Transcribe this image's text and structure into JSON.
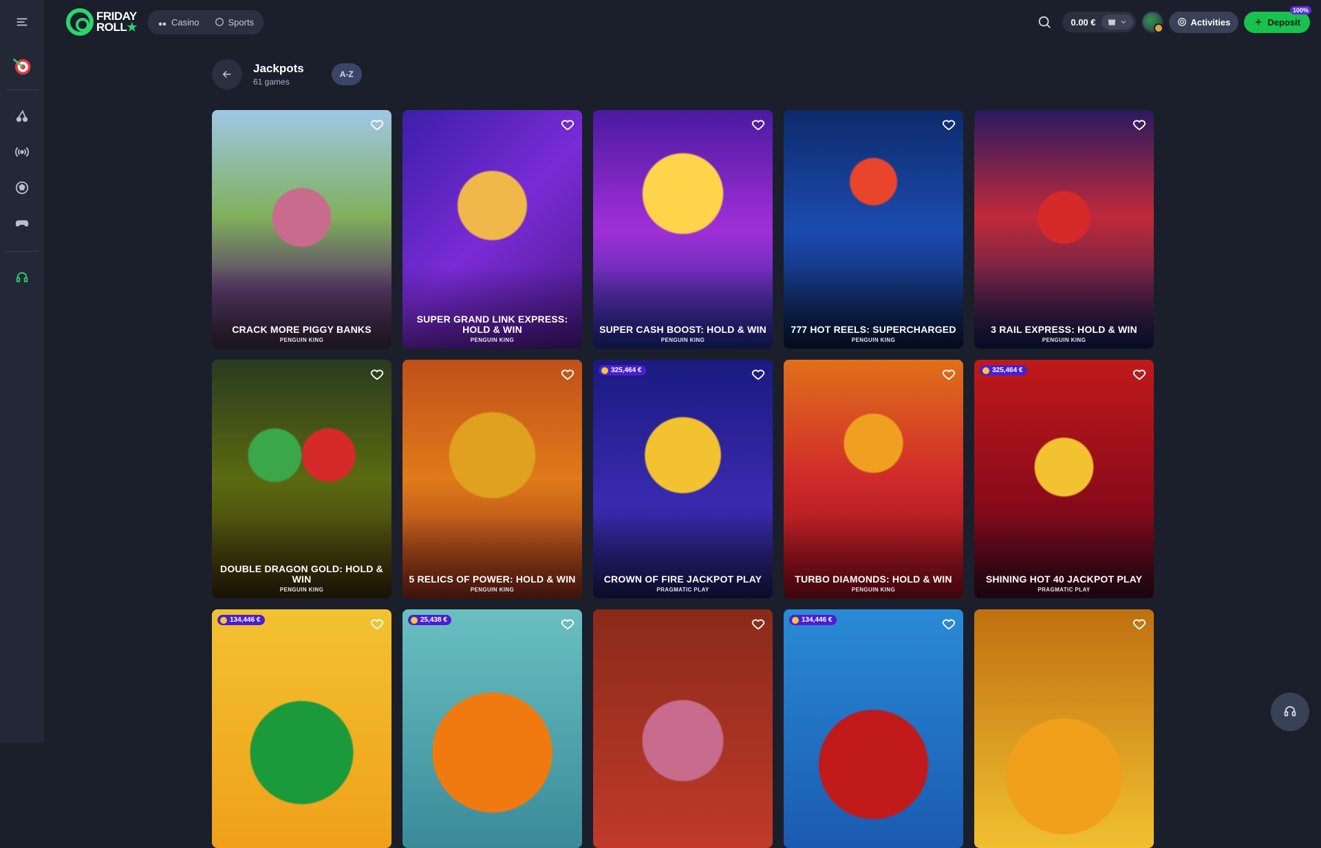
{
  "brand": {
    "name_line1": "FRIDAY",
    "name_line2": "ROLL",
    "name_star": "★"
  },
  "nav": {
    "casino_label": "Casino",
    "sports_label": "Sports"
  },
  "account": {
    "balance": "0.00 €",
    "activities_label": "Activities",
    "deposit_label": "Deposit",
    "deposit_badge": "100%"
  },
  "page": {
    "title": "Jackpots",
    "subtitle": "61 games",
    "sort_label": "A-Z"
  },
  "games": [
    {
      "name": "CRACK MORE PIGGY BANKS",
      "provider": "PENGUIN KING",
      "jackpot": ""
    },
    {
      "name": "SUPER GRAND LINK EXPRESS: HOLD & WIN",
      "provider": "PENGUIN KING",
      "jackpot": ""
    },
    {
      "name": "SUPER CASH BOOST: HOLD & WIN",
      "provider": "PENGUIN KING",
      "jackpot": ""
    },
    {
      "name": "777 HOT REELS: SUPERCHARGED",
      "provider": "PENGUIN KING",
      "jackpot": ""
    },
    {
      "name": "3 RAIL EXPRESS: HOLD & WIN",
      "provider": "PENGUIN KING",
      "jackpot": ""
    },
    {
      "name": "DOUBLE DRAGON GOLD: HOLD & WIN",
      "provider": "PENGUIN KING",
      "jackpot": ""
    },
    {
      "name": "5 RELICS OF POWER: HOLD & WIN",
      "provider": "PENGUIN KING",
      "jackpot": ""
    },
    {
      "name": "CROWN OF FIRE JACKPOT PLAY",
      "provider": "PRAGMATIC PLAY",
      "jackpot": "325,464 €"
    },
    {
      "name": "TURBO DIAMONDS: HOLD & WIN",
      "provider": "PENGUIN KING",
      "jackpot": ""
    },
    {
      "name": "SHINING HOT 40 JACKPOT PLAY",
      "provider": "PRAGMATIC PLAY",
      "jackpot": "325,464 €"
    },
    {
      "name": "",
      "provider": "",
      "jackpot": "134,446 €"
    },
    {
      "name": "",
      "provider": "",
      "jackpot": "25,438 €"
    },
    {
      "name": "",
      "provider": "",
      "jackpot": ""
    },
    {
      "name": "",
      "provider": "",
      "jackpot": "134,446 €"
    },
    {
      "name": "",
      "provider": "",
      "jackpot": ""
    }
  ],
  "colors": {
    "accent_green": "#19c14e",
    "jackpot_badge": "#4b1fd1",
    "background": "#1b1f2b",
    "sidebar": "#232836"
  }
}
